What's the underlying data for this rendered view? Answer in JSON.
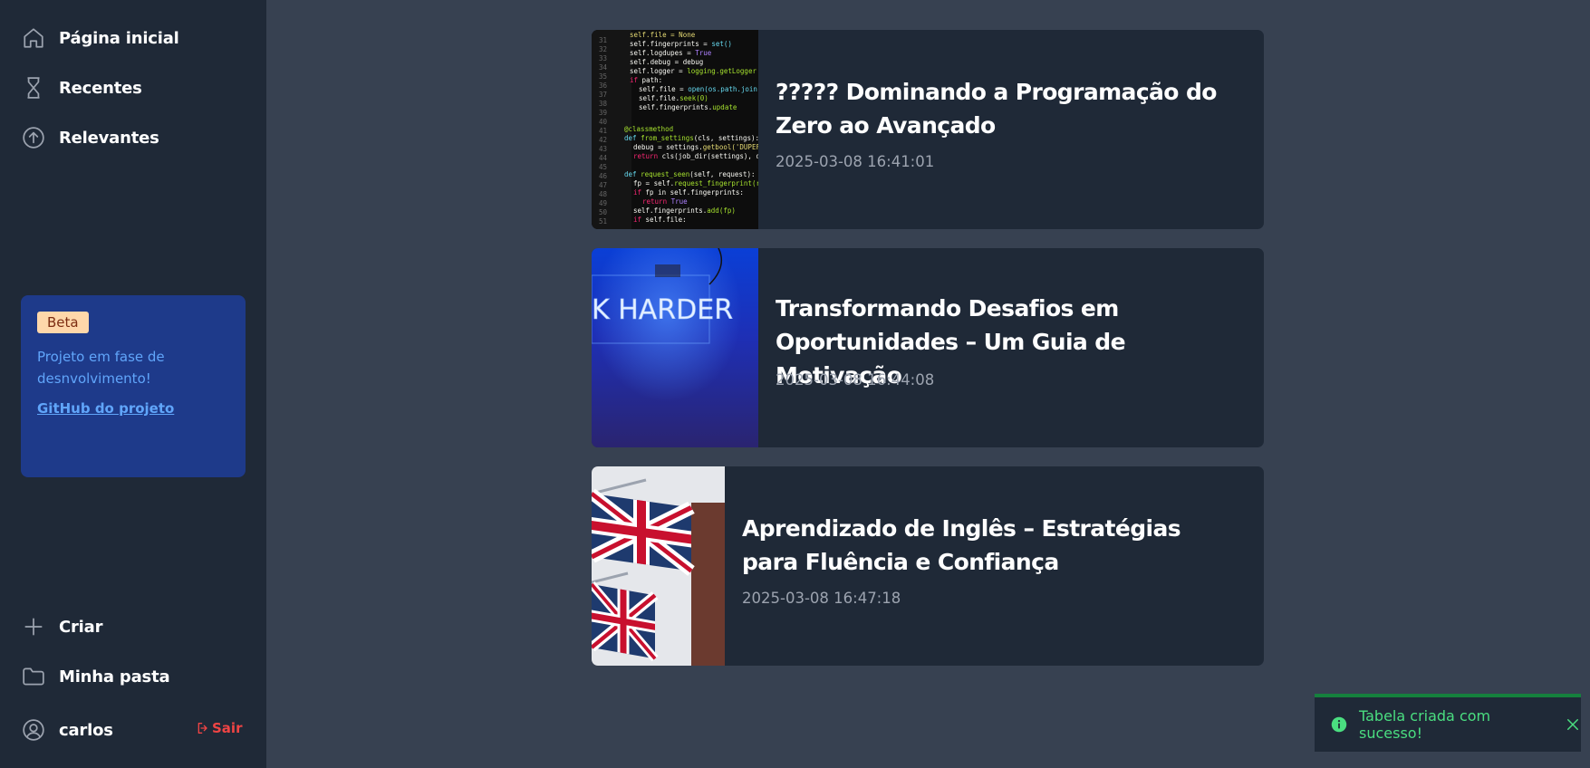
{
  "sidebar": {
    "nav_top": [
      {
        "label": "Página inicial",
        "icon": "home-icon"
      },
      {
        "label": "Recentes",
        "icon": "hourglass-icon"
      },
      {
        "label": "Relevantes",
        "icon": "arrow-up-circle-icon"
      }
    ],
    "beta": {
      "badge": "Beta",
      "text": "Projeto em fase de desnvolvimento!",
      "link": "GitHub do projeto"
    },
    "nav_bottom": [
      {
        "label": "Criar",
        "icon": "plus-icon"
      },
      {
        "label": "Minha pasta",
        "icon": "folder-icon"
      }
    ],
    "user": {
      "name": "carlos",
      "icon": "user-circle-icon"
    },
    "logout": {
      "label": "Sair",
      "icon": "logout-icon"
    }
  },
  "posts": [
    {
      "title": "????? Dominando a Programação do Zero ao Avançado",
      "date": "2025-03-08 16:41:01",
      "thumb": "code-screen-image"
    },
    {
      "title": "Transformando Desafios em Oportunidades – Um Guia de Motivação",
      "date": "2025-03-08 16:44:08",
      "thumb": "neon-harder-sign-image"
    },
    {
      "title": "Aprendizado de Inglês – Estratégias para Fluência e Confiança",
      "date": "2025-03-08 16:47:18",
      "thumb": "union-jack-flags-image"
    }
  ],
  "toast": {
    "message": "Tabela criada com sucesso!",
    "icon": "info-icon",
    "close_icon": "close-icon"
  },
  "colors": {
    "background": "#374151",
    "sidebar": "#1f2937",
    "card": "#1f2937",
    "beta_card": "#1e3a8a",
    "accent_link": "#60a5fa",
    "logout": "#ef4444",
    "toast_success": "#4ade80"
  }
}
